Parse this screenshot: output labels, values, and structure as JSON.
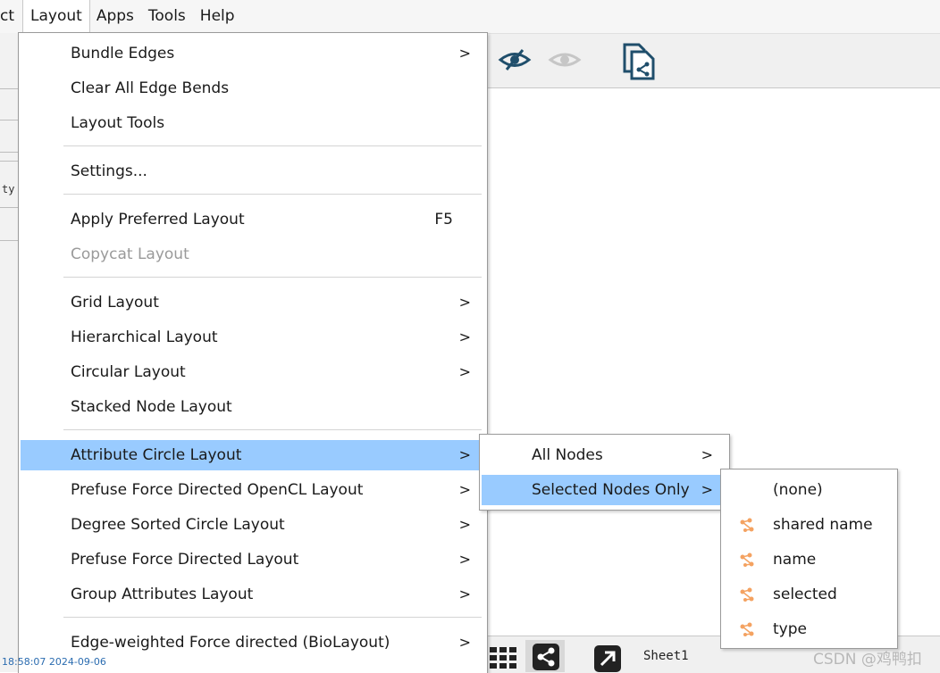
{
  "menubar": {
    "items": [
      {
        "label": "ct"
      },
      {
        "label": "Layout",
        "open": true
      },
      {
        "label": "Apps"
      },
      {
        "label": "Tools"
      },
      {
        "label": "Help"
      }
    ]
  },
  "layout_menu": {
    "items": [
      {
        "label": "Bundle Edges",
        "submenu": true
      },
      {
        "label": "Clear All Edge Bends"
      },
      {
        "label": "Layout Tools"
      },
      {
        "label": "Settings..."
      },
      {
        "label": "Apply Preferred Layout",
        "shortcut": "F5"
      },
      {
        "label": "Copycat Layout",
        "disabled": true
      },
      {
        "label": "Grid Layout",
        "submenu": true
      },
      {
        "label": "Hierarchical Layout",
        "submenu": true
      },
      {
        "label": "Circular Layout",
        "submenu": true
      },
      {
        "label": "Stacked Node Layout"
      },
      {
        "label": "Attribute Circle Layout",
        "submenu": true,
        "highlighted": true
      },
      {
        "label": "Prefuse Force Directed OpenCL Layout",
        "submenu": true
      },
      {
        "label": "Degree Sorted Circle Layout",
        "submenu": true
      },
      {
        "label": "Prefuse Force Directed Layout",
        "submenu": true
      },
      {
        "label": "Group Attributes Layout",
        "submenu": true
      },
      {
        "label": "Edge-weighted Force directed (BioLayout)",
        "submenu": true
      }
    ]
  },
  "attribute_submenu": {
    "items": [
      {
        "label": "All Nodes",
        "submenu": true
      },
      {
        "label": "Selected Nodes Only",
        "submenu": true,
        "highlighted": true
      }
    ]
  },
  "attribute_choice_menu": {
    "items": [
      {
        "label": "(none)"
      },
      {
        "label": "shared name",
        "icon": "node-attribute-icon"
      },
      {
        "label": "name",
        "icon": "node-attribute-icon"
      },
      {
        "label": "selected",
        "icon": "node-attribute-icon"
      },
      {
        "label": "type",
        "icon": "node-attribute-icon"
      }
    ]
  },
  "arrow_glyph": ">",
  "left_fragment": "ty",
  "bottom": {
    "sheet_label": "Sheet1"
  },
  "watermark": "CSDN @鸡鸭扣",
  "timestamp": "18:58:07 2024-09-06",
  "colors": {
    "highlight": "#99cbff",
    "icon_accent": "#f4a261",
    "toolbar_icon": "#1f4e6b"
  }
}
